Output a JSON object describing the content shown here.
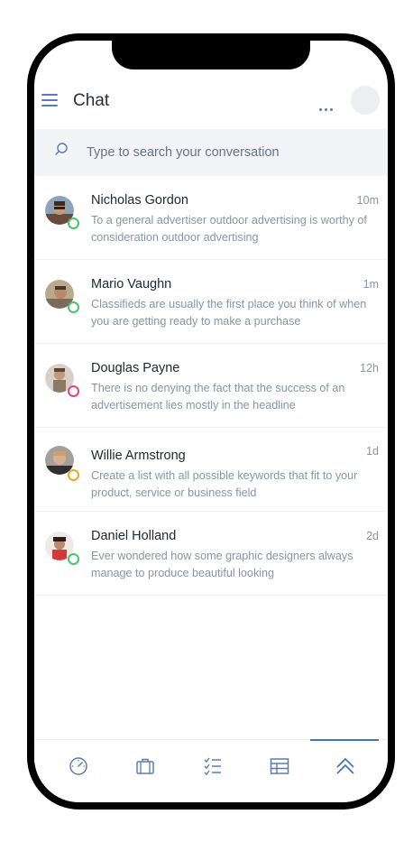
{
  "header": {
    "title": "Chat"
  },
  "search": {
    "placeholder": "Type to search your conversation"
  },
  "conversations": [
    {
      "name": "Nicholas Gordon",
      "time": "10m",
      "message": "To a general advertiser outdoor advertising is worthy of consideration outdoor advertising",
      "status_color": "#4cc36a"
    },
    {
      "name": "Mario Vaughn",
      "time": "1m",
      "message": "Classifieds are usually the first place you think of when you are getting ready to make a purchase",
      "status_color": "#4cc36a"
    },
    {
      "name": "Douglas Payne",
      "time": "12h",
      "message": "There is no denying the fact that the success of an advertisement lies mostly in the headline",
      "status_color": "#e8437c"
    },
    {
      "name": "Willie Armstrong",
      "time": "1d",
      "message": "Create a list with all possible keywords that fit to your product, service or business field",
      "status_color": "#f0a42b"
    },
    {
      "name": "Daniel Holland",
      "time": "2d",
      "message": "Ever wondered how some graphic designers always manage to produce beautiful looking",
      "status_color": "#4cc36a"
    }
  ],
  "nav": [
    {
      "icon": "speedometer-icon"
    },
    {
      "icon": "briefcase-icon"
    },
    {
      "icon": "checklist-icon"
    },
    {
      "icon": "table-icon"
    },
    {
      "icon": "double-chevron-up-icon",
      "active": true
    }
  ],
  "colors": {
    "accent": "#4a72c4",
    "online": "#4cc36a",
    "busy": "#e8437c",
    "away": "#f0a42b"
  }
}
